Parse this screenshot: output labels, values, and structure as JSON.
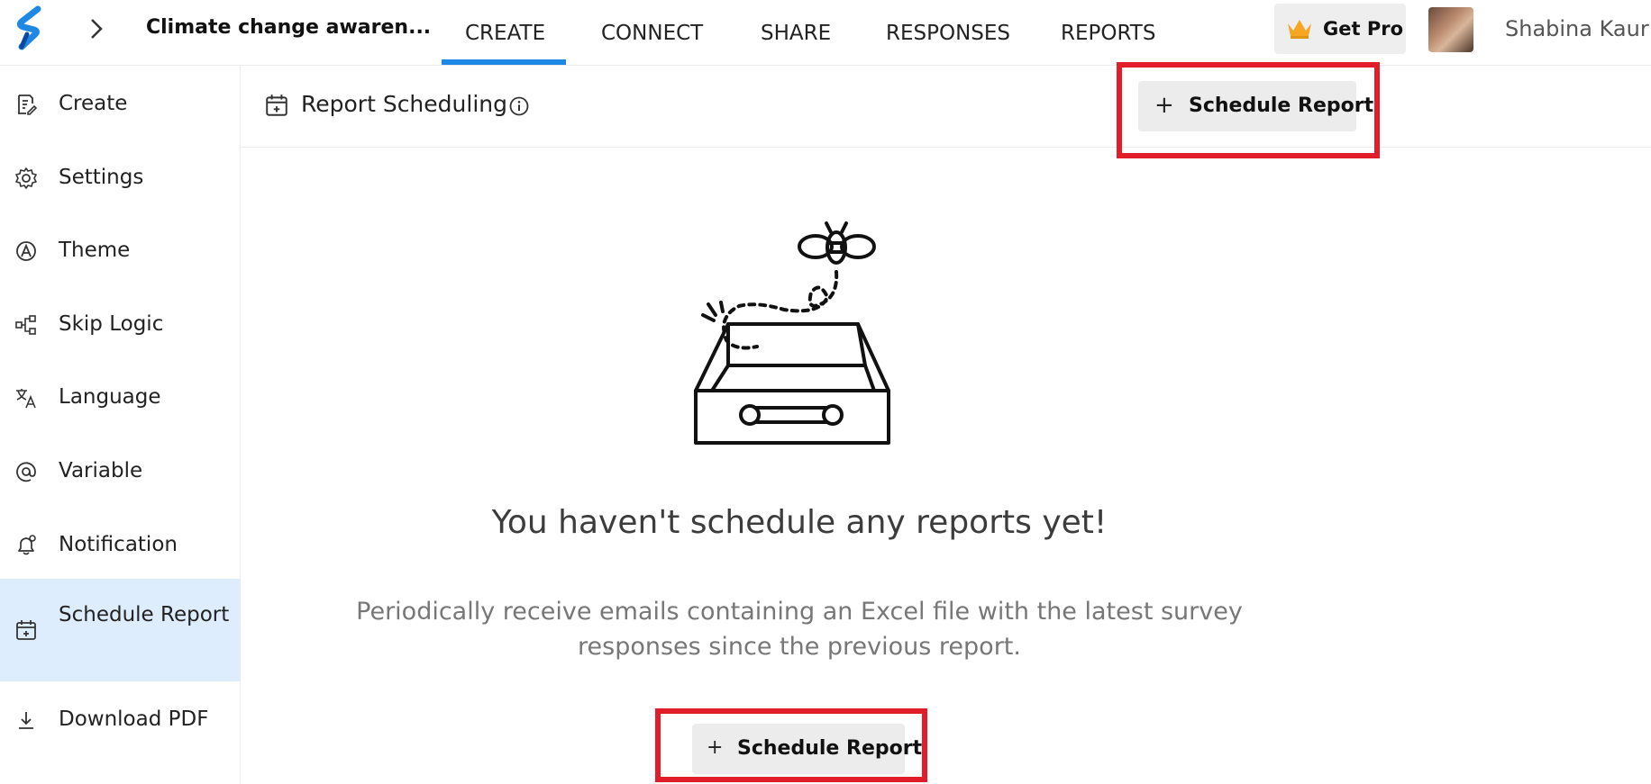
{
  "header": {
    "survey_title": "Climate change awaren...",
    "tabs": [
      {
        "label": "CREATE",
        "active": true
      },
      {
        "label": "CONNECT",
        "active": false
      },
      {
        "label": "SHARE",
        "active": false
      },
      {
        "label": "RESPONSES",
        "active": false
      },
      {
        "label": "REPORTS",
        "active": false
      }
    ],
    "get_pro_label": "Get Pro",
    "user_name": "Shabina Kaur",
    "accent_color": "#1e88e5"
  },
  "sidebar": {
    "items": [
      {
        "label": "Create",
        "icon": "form-edit-icon"
      },
      {
        "label": "Settings",
        "icon": "gear-icon"
      },
      {
        "label": "Theme",
        "icon": "theme-icon"
      },
      {
        "label": "Skip Logic",
        "icon": "flow-icon"
      },
      {
        "label": "Language",
        "icon": "translate-icon"
      },
      {
        "label": "Variable",
        "icon": "at-icon"
      },
      {
        "label": "Notification",
        "icon": "bell-icon"
      },
      {
        "label": "Schedule Report",
        "icon": "calendar-plus-icon",
        "active": true
      },
      {
        "label": "Download PDF",
        "icon": "download-icon"
      }
    ]
  },
  "main": {
    "page_title": "Report Scheduling",
    "schedule_button_label": "Schedule Report",
    "empty_title": "You haven't schedule any reports yet!",
    "empty_description": "Periodically receive emails containing an Excel file with the latest survey responses since the previous report.",
    "highlight_color": "#e11d2a"
  }
}
